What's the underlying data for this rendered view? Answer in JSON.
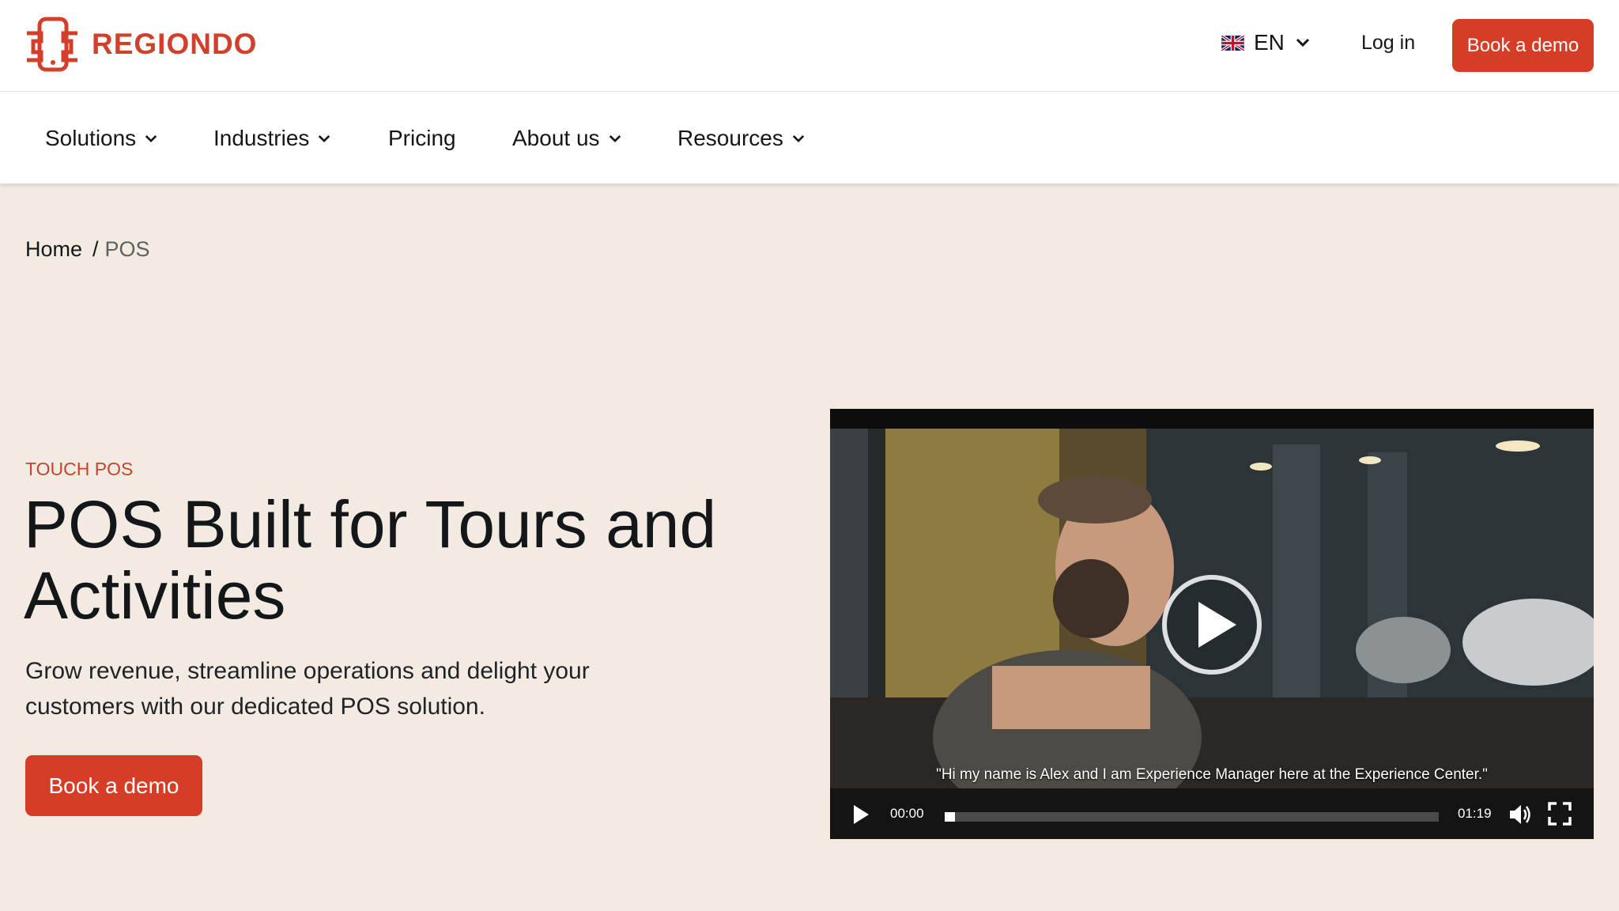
{
  "header": {
    "logo_text": "REGIONDO",
    "language": "EN",
    "login_label": "Log in",
    "demo_label": "Book a demo"
  },
  "nav": {
    "items": [
      {
        "label": "Solutions",
        "has_dropdown": true
      },
      {
        "label": "Industries",
        "has_dropdown": true
      },
      {
        "label": "Pricing",
        "has_dropdown": false
      },
      {
        "label": "About us",
        "has_dropdown": true
      },
      {
        "label": "Resources",
        "has_dropdown": true
      }
    ]
  },
  "breadcrumb": {
    "home": "Home",
    "separator": "/",
    "current": "POS"
  },
  "hero": {
    "eyebrow": "TOUCH POS",
    "title": "POS Built for Tours and Activities",
    "subtitle": "Grow revenue, streamline operations and delight your customers with our dedicated POS solution.",
    "cta_label": "Book a demo"
  },
  "video": {
    "caption": "\"Hi my name is Alex and I am Experience Manager here at the Experience Center.\"",
    "current_time": "00:00",
    "duration": "01:19",
    "progress": 0.02
  },
  "colors": {
    "brand": "#d63d27",
    "background": "#f3ebe2",
    "text": "#14171a"
  },
  "icons": [
    "regiondo-logo-icon",
    "uk-flag-icon",
    "chevron-down-icon",
    "play-icon",
    "volume-icon",
    "fullscreen-icon"
  ]
}
